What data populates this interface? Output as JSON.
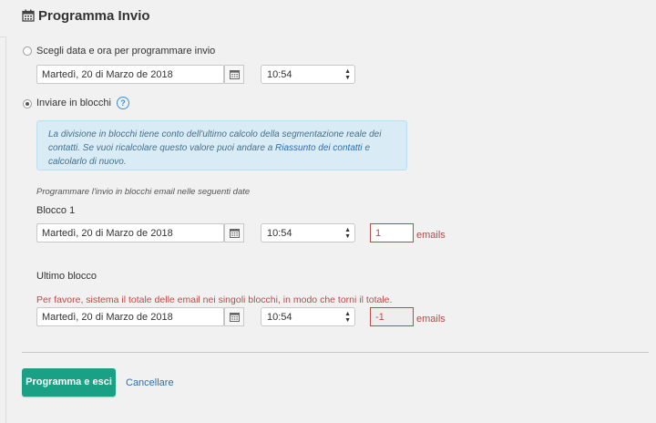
{
  "header": {
    "title": "Programma Invio",
    "icon": "calendar-icon"
  },
  "schedule_option": {
    "label": "Scegli data e ora per programmare invio",
    "checked": false
  },
  "schedule_row": {
    "date": "Martedì, 20 di Marzo de 2018",
    "time": "10:54"
  },
  "blocks_option": {
    "label": "Inviare in blocchi",
    "checked": true,
    "help": "?"
  },
  "info": {
    "text_before": "La divisione in blocchi tiene conto dell'ultimo calcolo della segmentazione reale dei contatti. Se vuoi ricalcolare questo valore puoi andare a ",
    "link": "Riassunto dei contatti",
    "text_after": " e calcolarlo di nuovo."
  },
  "blocks_hint": "Programmare l'invio in blocchi email nelle seguenti date",
  "block1": {
    "label": "Blocco 1",
    "date": "Martedì, 20 di Marzo de 2018",
    "time": "10:54",
    "qty": "1",
    "qty_unit": "emails"
  },
  "last_block": {
    "label": "Ultimo blocco",
    "error": "Per favore, sistema il totale delle email nei singoli blocchi, in modo che torni il totale.",
    "date": "Martedì, 20 di Marzo de 2018",
    "time": "10:54",
    "qty": "-1",
    "qty_unit": "emails"
  },
  "actions": {
    "submit": "Programma e esci",
    "cancel": "Cancellare"
  },
  "colors": {
    "primary": "#1aa085",
    "error": "#b94a48",
    "link": "#2a6fb0",
    "info_bg": "#d9ecf6"
  }
}
